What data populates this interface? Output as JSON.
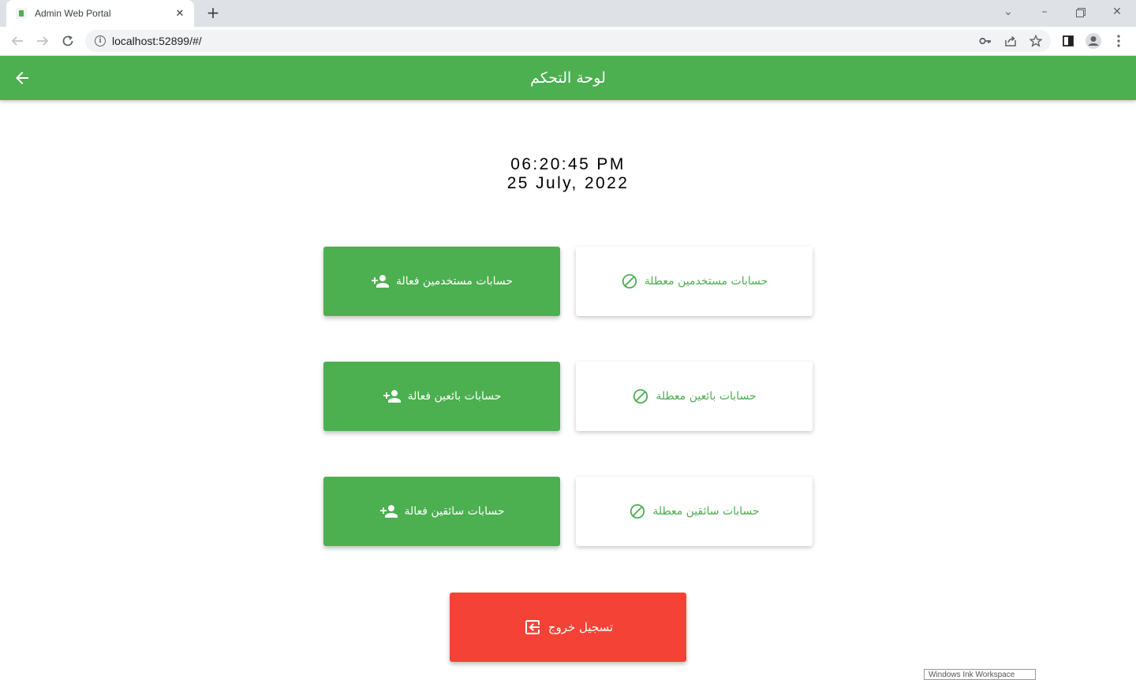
{
  "browser": {
    "tab_title": "Admin Web Portal",
    "tab_close": "✕",
    "new_tab": "+",
    "url": "localhost:52899/#/"
  },
  "appbar": {
    "title": "لوحة التحكم"
  },
  "clock": {
    "time": "06:20:45 PM",
    "date": "25 July, 2022"
  },
  "cards": {
    "active_users": "حسابات مستخدمين فعالة",
    "blocked_users": "حسابات مستخدمين معطلة",
    "active_sellers": "حسابات بائعين فعالة",
    "blocked_sellers": "حسابات بائعين معطلة",
    "active_drivers": "حسابات سائقين فعالة",
    "blocked_drivers": "حسابات سائقين معطلة",
    "logout": "تسجيل خروج"
  },
  "overlay": {
    "ink_workspace": "Windows Ink Workspace"
  },
  "colors": {
    "primary": "#4caf50",
    "danger": "#f44336",
    "tabbar": "#dee1e6"
  },
  "icons": {
    "back": "arrow-back-icon",
    "add_user": "person-add-icon",
    "block": "block-icon",
    "logout": "logout-icon"
  }
}
